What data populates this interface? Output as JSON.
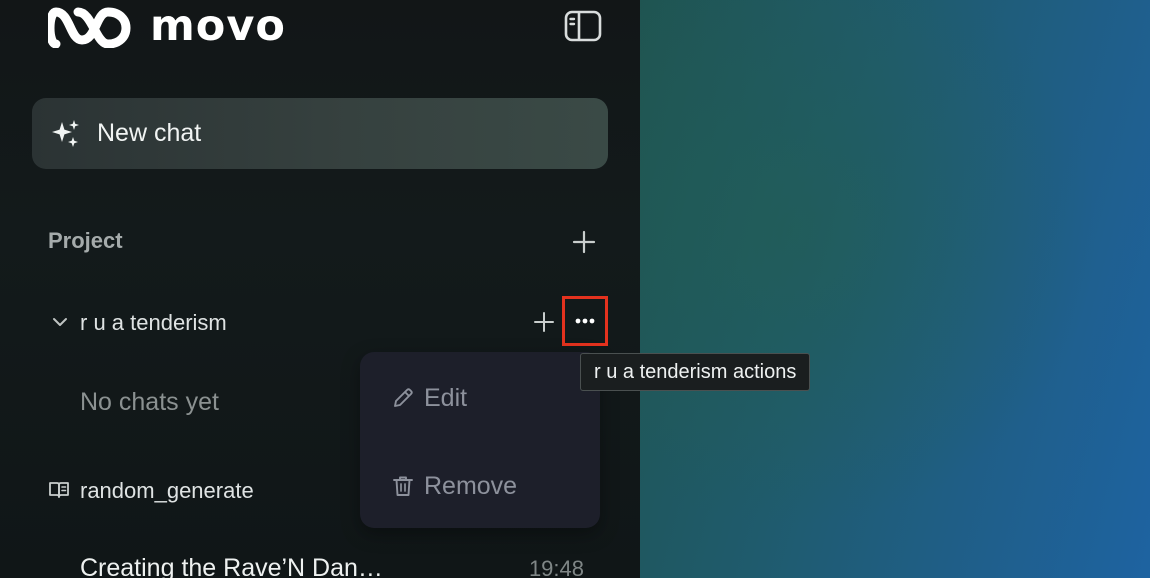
{
  "app": {
    "brand": "movo"
  },
  "sidebar": {
    "new_chat_label": "New chat",
    "section_title": "Project",
    "projects": [
      {
        "name": "r u a tenderism",
        "expanded": true,
        "empty_text": "No chats yet"
      },
      {
        "name": "random_generate",
        "chats": [
          {
            "title": "Creating the Rave’N Dan…",
            "time": "19:48"
          }
        ]
      }
    ]
  },
  "menu": {
    "items": [
      {
        "label": "Edit",
        "icon": "pencil-icon"
      },
      {
        "label": "Remove",
        "icon": "trash-icon"
      }
    ]
  },
  "tooltip": {
    "text": "r u a tenderism actions"
  },
  "colors": {
    "highlight_border": "#e4321e",
    "menu_bg": "#1d1f2a",
    "accent_blue": "#1e64a0"
  }
}
